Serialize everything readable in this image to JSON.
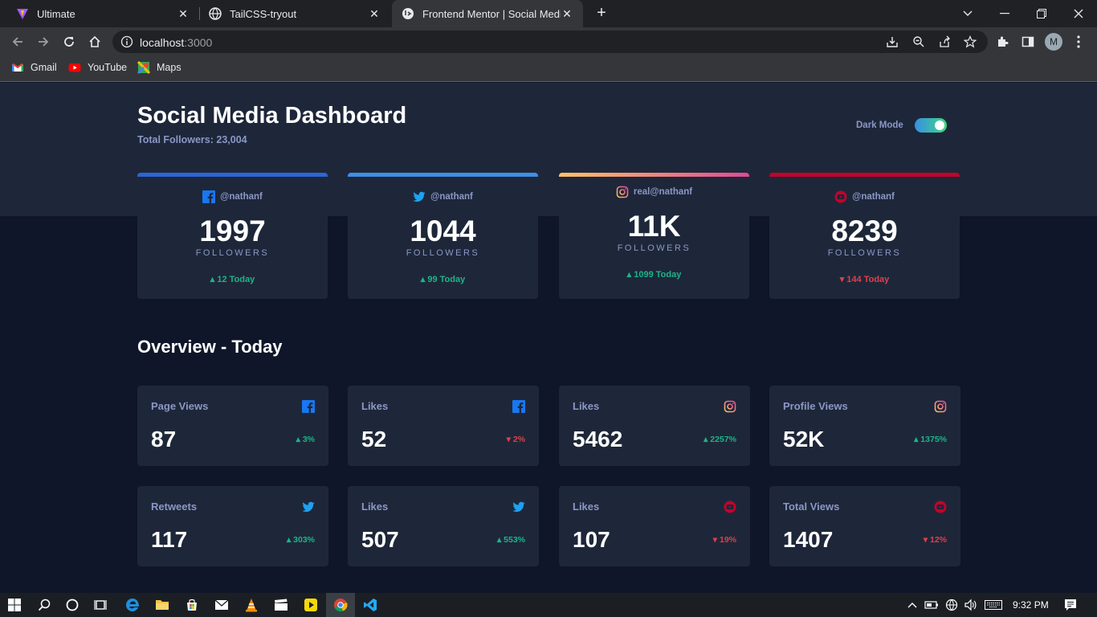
{
  "browser": {
    "tabs": [
      {
        "title": "Ultimate",
        "icon": "vite-icon"
      },
      {
        "title": "TailCSS-tryout",
        "icon": "globe-icon"
      },
      {
        "title": "Frontend Mentor | Social Media D",
        "icon": "frontend-mentor-icon"
      }
    ],
    "url_host": "localhost",
    "url_port": ":3000",
    "profile_initial": "M",
    "bookmarks": [
      {
        "label": "Gmail",
        "icon": "gmail-icon"
      },
      {
        "label": "YouTube",
        "icon": "youtube-icon"
      },
      {
        "label": "Maps",
        "icon": "maps-icon"
      }
    ]
  },
  "dashboard": {
    "title": "Social Media Dashboard",
    "total_followers": "Total Followers: 23,004",
    "dark_mode_label": "Dark Mode",
    "dark_mode_on": true,
    "cards": [
      {
        "network": "facebook",
        "handle": "@nathanf",
        "count": "1997",
        "label": "FOLLOWERS",
        "today": "12 Today",
        "trend": "up",
        "color": "#2e64d6"
      },
      {
        "network": "twitter",
        "handle": "@nathanf",
        "count": "1044",
        "label": "FOLLOWERS",
        "today": "99 Today",
        "trend": "up",
        "color": "#3f8ee8"
      },
      {
        "network": "instagram",
        "handle": "real@nathanf",
        "count": "11K",
        "label": "FOLLOWERS",
        "today": "1099 Today",
        "trend": "up",
        "color": "#df63a0"
      },
      {
        "network": "youtube",
        "handle": "@nathanf",
        "count": "8239",
        "label": "FOLLOWERS",
        "today": "144 Today",
        "trend": "down",
        "color": "#c4032b"
      }
    ],
    "overview_title": "Overview - Today",
    "overview": [
      {
        "title": "Page Views",
        "network": "facebook",
        "value": "87",
        "percent": "3%",
        "trend": "up"
      },
      {
        "title": "Likes",
        "network": "facebook",
        "value": "52",
        "percent": "2%",
        "trend": "down"
      },
      {
        "title": "Likes",
        "network": "instagram",
        "value": "5462",
        "percent": "2257%",
        "trend": "up"
      },
      {
        "title": "Profile Views",
        "network": "instagram",
        "value": "52K",
        "percent": "1375%",
        "trend": "up"
      },
      {
        "title": "Retweets",
        "network": "twitter",
        "value": "117",
        "percent": "303%",
        "trend": "up"
      },
      {
        "title": "Likes",
        "network": "twitter",
        "value": "507",
        "percent": "553%",
        "trend": "up"
      },
      {
        "title": "Likes",
        "network": "youtube",
        "value": "107",
        "percent": "19%",
        "trend": "down"
      },
      {
        "title": "Total Views",
        "network": "youtube",
        "value": "1407",
        "percent": "12%",
        "trend": "down"
      }
    ]
  },
  "taskbar": {
    "time": "9:32 PM"
  }
}
